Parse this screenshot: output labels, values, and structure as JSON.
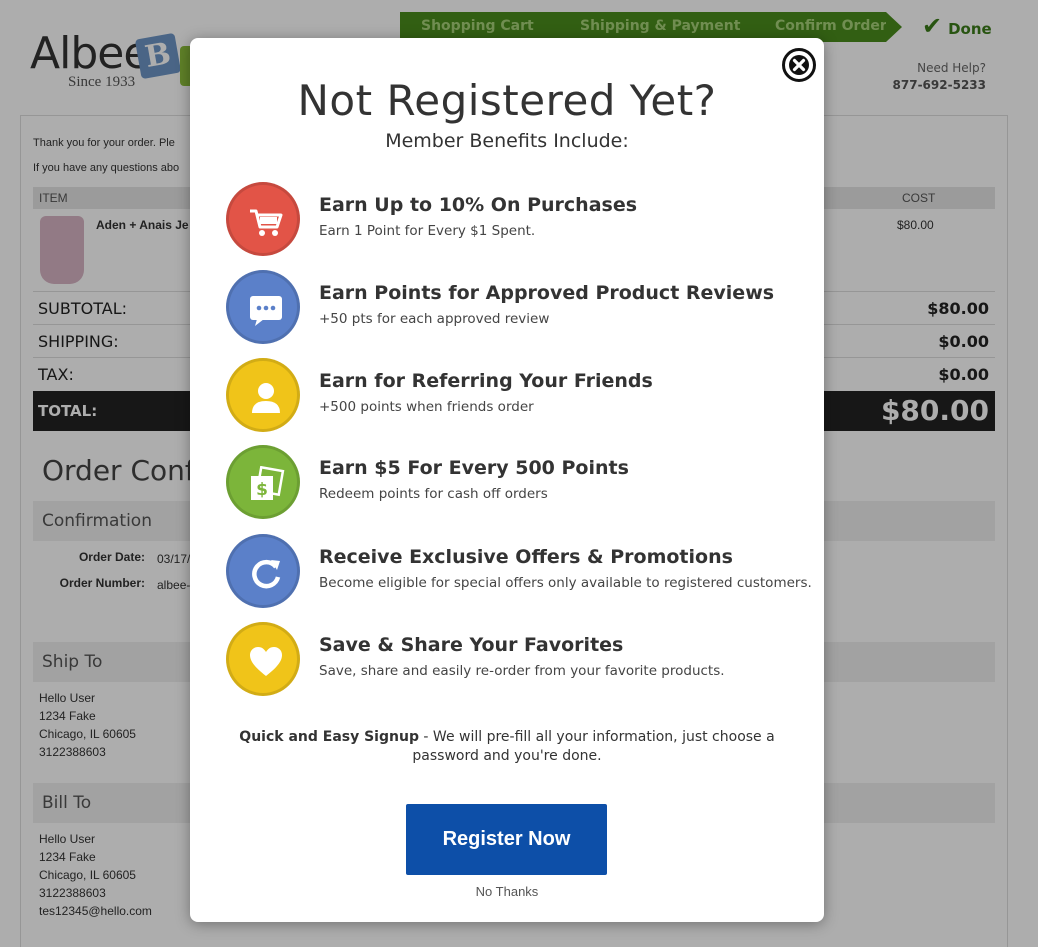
{
  "site": {
    "logo_text": "Albee",
    "logo_since": "Since 1933",
    "logo_block_letter": "B",
    "steps": [
      "Shopping Cart",
      "Shipping & Payment",
      "Confirm Order"
    ],
    "done_label": "Done",
    "help_label": "Need Help?",
    "help_phone": "877-692-5233"
  },
  "order": {
    "thank_you_text": "Thank you for your order. Ple",
    "questions_text": "If you have any questions abo",
    "col_item": "ITEM",
    "col_cost": "COST",
    "product_name": "Aden + Anais Je",
    "product_cost": "$80.00",
    "subtotal_label": "SUBTOTAL:",
    "subtotal_value": "$80.00",
    "shipping_label": "SHIPPING:",
    "shipping_value": "$0.00",
    "tax_label": "TAX:",
    "tax_value": "$0.00",
    "total_label": "TOTAL:",
    "total_value": "$80.00",
    "confirmation_title": "Order Confi",
    "confirmation_head": "Confirmation",
    "order_date_label": "Order Date:",
    "order_date_value": "03/17/",
    "order_number_label": "Order Number:",
    "order_number_value": "albee-",
    "ship_to_head": "Ship To",
    "ship_to_lines": [
      "Hello User",
      "1234 Fake",
      "Chicago, IL 60605",
      "3122388603"
    ],
    "bill_to_head": "Bill To",
    "bill_to_lines": [
      "Hello User",
      "1234 Fake",
      "Chicago, IL 60605",
      "3122388603",
      "tes12345@hello.com"
    ]
  },
  "modal": {
    "title": "Not Registered Yet?",
    "subtitle": "Member Benefits Include:",
    "benefits": [
      {
        "icon": "cart-icon",
        "color": "#e25447",
        "title": "Earn Up to 10% On Purchases",
        "desc": "Earn 1 Point for Every $1 Spent."
      },
      {
        "icon": "chat-bubble-icon",
        "color": "#5b80c9",
        "title": "Earn Points for Approved Product Reviews",
        "desc": "+50 pts for each approved review"
      },
      {
        "icon": "person-icon",
        "color": "#f0c419",
        "title": "Earn for Referring Your Friends",
        "desc": "+500 points when friends order"
      },
      {
        "icon": "cash-icon",
        "color": "#7cb53a",
        "title": "Earn $5 For Every 500 Points",
        "desc": "Redeem points for cash off orders"
      },
      {
        "icon": "refresh-icon",
        "color": "#5b80c9",
        "title": "Receive Exclusive Offers & Promotions",
        "desc": "Become eligible for special offers only available to registered customers."
      },
      {
        "icon": "heart-icon",
        "color": "#f0c419",
        "title": "Save & Share Your Favorites",
        "desc": "Save, share and easily re-order from your favorite products."
      }
    ],
    "signup_bold": "Quick and Easy Signup",
    "signup_text": " - We will pre-fill all your information, just choose a password and you're done.",
    "register_label": "Register Now",
    "no_thanks_label": "No Thanks"
  }
}
